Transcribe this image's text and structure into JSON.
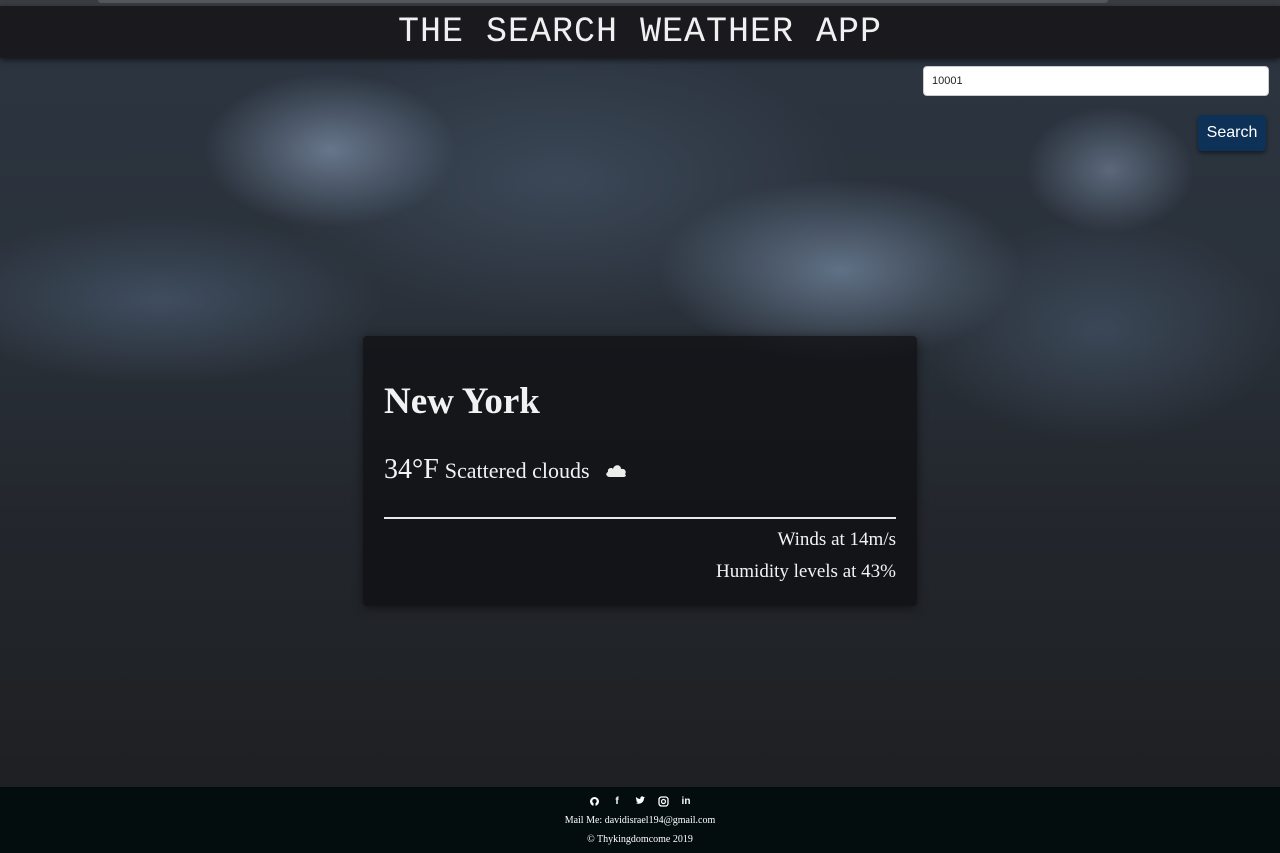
{
  "header": {
    "title": "THE SEARCH WEATHER APP"
  },
  "search": {
    "value": "10001",
    "button_label": "Search"
  },
  "weather": {
    "city": "New York",
    "temperature": "34°F",
    "description": "Scattered clouds",
    "icon": "cloud-icon",
    "winds": "Winds at 14m/s",
    "humidity": "Humidity levels at 43%"
  },
  "footer": {
    "social_icons": [
      "github-icon",
      "facebook-icon",
      "twitter-icon",
      "instagram-icon",
      "linkedin-icon"
    ],
    "mail": "Mail Me: davidisrael194@gmail.com",
    "copyright": "© Thykingdomcome 2019"
  },
  "colors": {
    "button": "#0d3157",
    "footer": "#040d0d",
    "header": "#141214"
  }
}
